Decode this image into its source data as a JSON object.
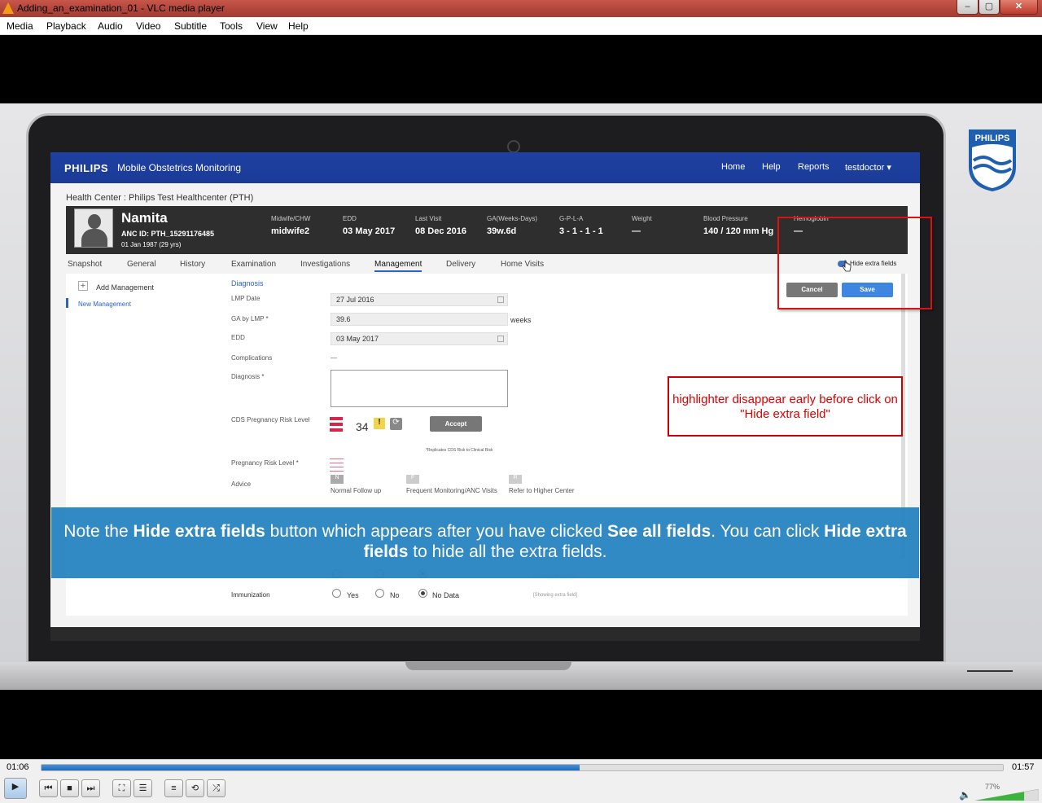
{
  "window": {
    "title": "Adding_an_examination_01 - VLC media player",
    "min": "–",
    "max": "▢",
    "close": "✕"
  },
  "menu": [
    "Media",
    "Playback",
    "Audio",
    "Video",
    "Subtitle",
    "Tools",
    "View",
    "Help"
  ],
  "app": {
    "brand": "PHILIPS",
    "name": "Mobile Obstetrics Monitoring",
    "nav": [
      "Home",
      "Help",
      "Reports",
      "testdoctor ▾"
    ],
    "health_center": "Health Center : Philips Test Healthcenter (PTH)",
    "patient": {
      "name": "Namita",
      "anc_id": "ANC ID: PTH_15291176485",
      "dob": "01 Jan 1987 (29 yrs)"
    },
    "stats": [
      {
        "label": "Midwife/CHW",
        "value": "midwife2"
      },
      {
        "label": "EDD",
        "value": "03 May 2017"
      },
      {
        "label": "Last Visit",
        "value": "08 Dec 2016"
      },
      {
        "label": "GA(Weeks-Days)",
        "value": "39w.6d"
      },
      {
        "label": "G-P-L-A",
        "value": "3 - 1 - 1 - 1"
      },
      {
        "label": "Weight",
        "value": "—"
      },
      {
        "label": "Blood Pressure",
        "value": "140 / 120 mm Hg"
      },
      {
        "label": "Hemoglobin",
        "value": "—"
      }
    ],
    "tabs": [
      "Snapshot",
      "General",
      "History",
      "Examination",
      "Investigations",
      "Management",
      "Delivery",
      "Home Visits"
    ],
    "active_tab": "Management",
    "hide_extra": "Hide extra fields",
    "left": {
      "add": "Add Management",
      "new": "New Management"
    },
    "form": {
      "section": "Diagnosis",
      "lmp_label": "LMP Date",
      "lmp_value": "27 Jul 2016",
      "ga_label": "GA by LMP *",
      "ga_value": "39.6",
      "ga_unit": "weeks",
      "edd_label": "EDD",
      "edd_value": "03 May 2017",
      "comp_label": "Complications",
      "comp_value": "—",
      "diag_label": "Diagnosis *",
      "cds_label": "CDS Pregnancy Risk Level",
      "cds_score": "34",
      "accept": "Accept",
      "cds_note": "*Replicates CDS Risk to Clinical Risk",
      "preg_risk_label": "Pregnancy Risk Level *",
      "advice_label": "Advice",
      "advice": [
        {
          "code": "N",
          "text": "Normal Follow up"
        },
        {
          "code": "F",
          "text": "Frequent Monitoring/ANC Visits"
        },
        {
          "code": "R",
          "text": "Refer to Higher Center"
        }
      ],
      "immunization_label": "Immunization",
      "radio_yes": "Yes",
      "radio_no": "No",
      "radio_nodata": "No Data",
      "showing_extra": "[Showing extra field]",
      "cancel": "Cancel",
      "save": "Save"
    }
  },
  "note": "highlighter disappear early before click on \"Hide extra field\"",
  "caption": {
    "p1": "Note the ",
    "b1": "Hide extra fields",
    "p2": " button which appears after you have clicked ",
    "b2": "See all fields",
    "p3": ". You can click ",
    "b3": "Hide extra fields",
    "p4": " to hide all the extra fields."
  },
  "player": {
    "time_current": "01:06",
    "time_total": "01:57",
    "progress": 0.56,
    "volume_pct": "77%",
    "volume": 0.77,
    "accent": "#1f6bb8"
  }
}
